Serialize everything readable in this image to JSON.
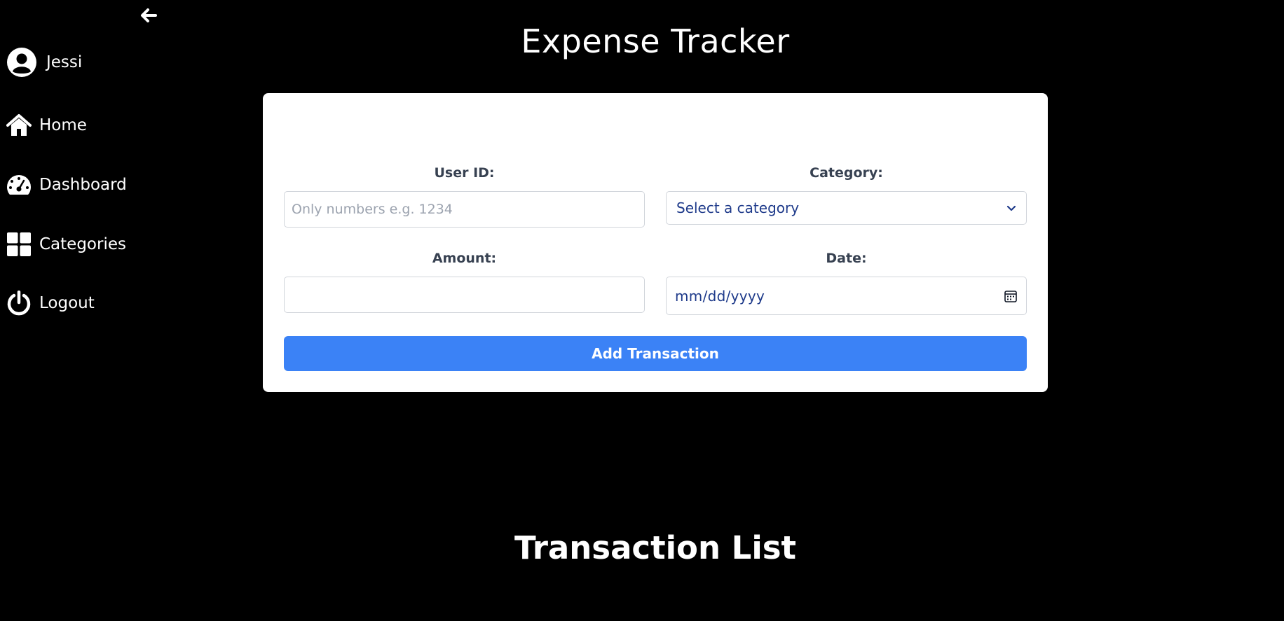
{
  "app": {
    "title": "Expense Tracker"
  },
  "sidebar": {
    "user": {
      "name": "Jessi",
      "icon": "user-circle-icon"
    },
    "items": [
      {
        "label": "Home",
        "icon": "home-icon"
      },
      {
        "label": "Dashboard",
        "icon": "speedometer-icon"
      },
      {
        "label": "Categories",
        "icon": "grid-icon"
      },
      {
        "label": "Logout",
        "icon": "power-icon"
      }
    ],
    "collapse_icon": "arrow-left-icon"
  },
  "form": {
    "user_id": {
      "label": "User ID:",
      "placeholder": "Only numbers e.g. 1234",
      "value": ""
    },
    "category": {
      "label": "Category:",
      "selected": "Select a category"
    },
    "amount": {
      "label": "Amount:",
      "value": ""
    },
    "date": {
      "label": "Date:",
      "placeholder": "mm/dd/yyyy"
    },
    "submit_label": "Add Transaction"
  },
  "transactions": {
    "title": "Transaction List"
  },
  "colors": {
    "background": "#000000",
    "card": "#ffffff",
    "primary_button": "#3b82f6",
    "input_text": "#1e3a8a",
    "label_text": "#374151"
  }
}
